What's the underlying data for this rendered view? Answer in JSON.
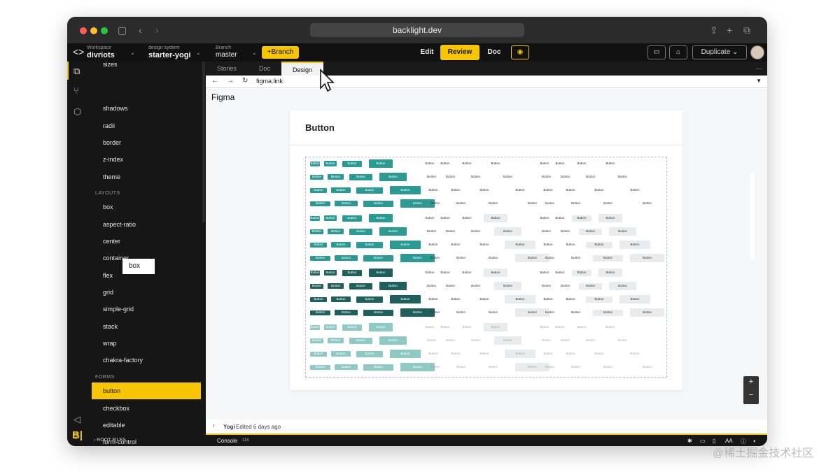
{
  "browser": {
    "url": "backlight.dev"
  },
  "app": {
    "workspace_label": "Workspace",
    "workspace_value": "divriots",
    "design_system_label": "design system",
    "design_system_value": "starter-yogi",
    "branch_label": "Branch",
    "branch_value": "master",
    "branch_button": "+Branch",
    "modes": [
      "Edit",
      "Review",
      "Doc"
    ],
    "active_mode": "Review",
    "duplicate_label": "Duplicate"
  },
  "sidebar": {
    "items_top": [
      "sizes",
      "shadows",
      "radii",
      "border",
      "z-index",
      "theme"
    ],
    "section_layouts": "LAYOUTS",
    "items_layouts": [
      "box",
      "aspect-ratio",
      "center",
      "container",
      "flex",
      "grid",
      "simple-grid",
      "stack",
      "wrap",
      "chakra-factory"
    ],
    "section_forms": "FORMS",
    "items_forms": [
      "button",
      "checkbox",
      "editable",
      "form-control"
    ],
    "active_item": "button",
    "tooltip": "box",
    "root_files": "ROOT FILES"
  },
  "tabs": [
    "Stories",
    "Doc",
    "Design"
  ],
  "active_tab": "Design",
  "embed": {
    "url": "figma.link",
    "title": "Figma",
    "card_title": "Button",
    "button_text": "Button",
    "author": "Yogi",
    "edited": "Edited 6 days ago"
  },
  "console": {
    "label": "Console",
    "count": "115"
  },
  "watermark": "@稀土掘金技术社区",
  "colors": {
    "accent": "#f7c600",
    "teal": "#2b9a94",
    "teal_dark": "#1f5f5c",
    "teal_light": "#8fc9c5",
    "gray_button": "#e9ecef"
  }
}
